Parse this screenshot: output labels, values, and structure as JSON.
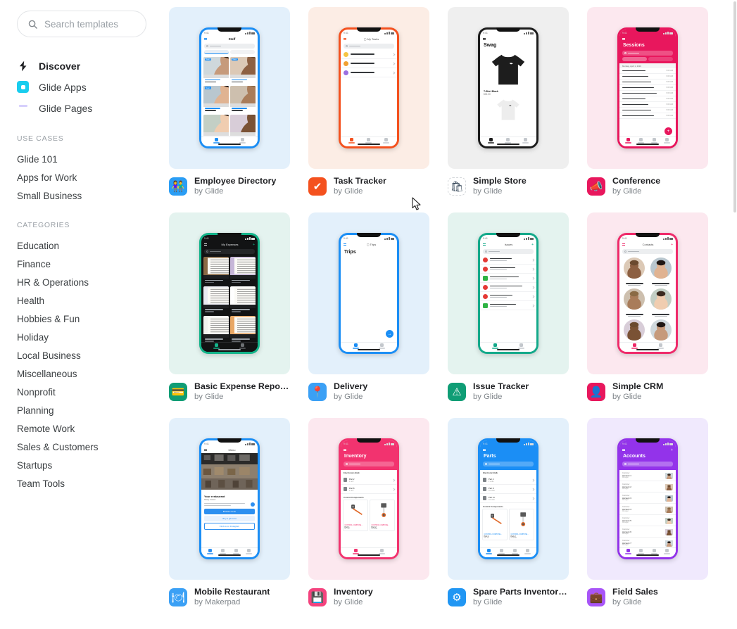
{
  "search": {
    "placeholder": "Search templates",
    "value": "",
    "icon": "search-icon"
  },
  "sidebar": {
    "nav": [
      {
        "label": "Discover",
        "icon": "lightning-bolt-icon",
        "active": true
      },
      {
        "label": "Glide Apps",
        "icon": "glide-apps-icon",
        "active": false
      },
      {
        "label": "Glide Pages",
        "icon": "glide-pages-icon",
        "active": false
      }
    ],
    "use_cases_header": "USE CASES",
    "use_cases": [
      "Glide 101",
      "Apps for Work",
      "Small Business"
    ],
    "categories_header": "CATEGORIES",
    "categories": [
      "Education",
      "Finance",
      "HR & Operations",
      "Health",
      "Hobbies & Fun",
      "Holiday",
      "Local Business",
      "Miscellaneous",
      "Nonprofit",
      "Planning",
      "Remote Work",
      "Sales & Customers",
      "Startups",
      "Team Tools"
    ]
  },
  "templates": [
    {
      "name": "Employee Directory",
      "author": "by Glide",
      "icon": "people-icon",
      "icon_glyph": "👫",
      "icon_bg": "#2a9df4",
      "card_bg": "#e3f0fb",
      "bezel": "#1b8ef5",
      "accent": "#1b8ef5",
      "screen_title": "Staff",
      "layout": "photo-grid-2col",
      "dark": false,
      "tabs": [
        "Staff",
        "Home"
      ]
    },
    {
      "name": "Task Tracker",
      "author": "by Glide",
      "icon": "checkmark-icon",
      "icon_glyph": "✔",
      "icon_bg": "#f4511e",
      "card_bg": "#fcede5",
      "bezel": "#f4511e",
      "accent": "#f4511e",
      "screen_title": "My Tasks",
      "layout": "emoji-list",
      "dark": false,
      "tabs": [
        "Categories",
        "All Tasks",
        "Done Tasks"
      ]
    },
    {
      "name": "Simple Store",
      "author": "by Glide",
      "icon": "shopping-bag-icon",
      "icon_glyph": "🛍",
      "icon_bg": "#ffffff",
      "card_bg": "#efefef",
      "bezel": "#1c1c1c",
      "accent": "#1c1c1c",
      "screen_title": "Swag",
      "layout": "product-hero",
      "dark": false,
      "product_name": "T-Shirt Black",
      "product_price": "$32.00",
      "tabs": [
        "Shop",
        "Cart",
        "Contact Us"
      ]
    },
    {
      "name": "Conference",
      "author": "by Glide",
      "icon": "megaphone-icon",
      "icon_glyph": "📣",
      "icon_bg": "#e8175d",
      "card_bg": "#fce8ef",
      "bezel": "#e8175d",
      "accent": "#e8175d",
      "screen_title": "Sessions",
      "layout": "session-list",
      "dark": false,
      "tabs": [
        "Sessions",
        "Speakers",
        "Venue",
        "Chat"
      ]
    },
    {
      "name": "Basic Expense Reporter",
      "author": "by Glide",
      "icon": "credit-card-icon",
      "icon_glyph": "💳",
      "icon_bg": "#0f9d75",
      "card_bg": "#e4f3ef",
      "bezel": "#13b48a",
      "accent": "#13b48a",
      "screen_title": "My Expenses",
      "layout": "receipt-grid",
      "dark": true,
      "tabs": [
        "My Expenses",
        "Reports"
      ]
    },
    {
      "name": "Delivery",
      "author": "by Glide",
      "icon": "location-pin-icon",
      "icon_glyph": "📍",
      "icon_bg": "#3ba0f5",
      "card_bg": "#e3f0fb",
      "bezel": "#1b8ef5",
      "accent": "#1b8ef5",
      "screen_title": "Trips",
      "layout": "empty-fab",
      "dark": false,
      "tabs": [
        "All Trips",
        "Drivers"
      ]
    },
    {
      "name": "Issue Tracker",
      "author": "by Glide",
      "icon": "warning-triangle-icon",
      "icon_glyph": "⚠",
      "icon_bg": "#0f9d75",
      "card_bg": "#e4f3ef",
      "bezel": "#13a98a",
      "accent": "#13a98a",
      "screen_title": "Issues",
      "layout": "status-list",
      "dark": false,
      "tabs": [
        "Issues",
        "By Group"
      ]
    },
    {
      "name": "Simple CRM",
      "author": "by Glide",
      "icon": "contact-person-icon",
      "icon_glyph": "👤",
      "icon_bg": "#e8175d",
      "card_bg": "#fce8ef",
      "bezel": "#ef2a6a",
      "accent": "#ef2a6a",
      "screen_title": "Contacts",
      "layout": "avatar-grid",
      "dark": false,
      "tabs": [
        "Contacts",
        "Tasks"
      ]
    },
    {
      "name": "Mobile Restaurant",
      "author": "by Makerpad",
      "icon": "restaurant-icon",
      "icon_glyph": "🍽",
      "icon_bg": "#3ba0f5",
      "card_bg": "#e3f0fb",
      "bezel": "#1b8ef5",
      "accent": "#2d8ff0",
      "screen_title": "Menu",
      "layout": "restaurant-hero",
      "dark": false,
      "hero_heading": "Your restaurant",
      "hero_sub": "Tasty. Good.",
      "buttons": [
        "Browse menu",
        "Buy a gift card",
        "Find us on Instagram"
      ],
      "tabs": [
        "Home",
        "Menu",
        "Cart",
        "Gift Cards"
      ]
    },
    {
      "name": "Inventory",
      "author": "by Glide",
      "icon": "save-disk-icon",
      "icon_glyph": "💾",
      "icon_bg": "#f4437e",
      "card_bg": "#fce8ef",
      "bezel": "#f2336f",
      "accent": "#f2336f",
      "screen_title": "Inventory",
      "layout": "inventory-list",
      "dark": false,
      "section_a": "Electronics Bulk",
      "section_b": "Control Components",
      "rows": [
        {
          "t": "Part 2",
          "s": "1 unit"
        },
        {
          "t": "Part 8",
          "s": "1 unit"
        }
      ],
      "tabs": [
        "Inventory",
        "Orders"
      ]
    },
    {
      "name": "Spare Parts Inventory...",
      "author": "by Glide",
      "icon": "gear-icon",
      "icon_glyph": "⚙",
      "icon_bg": "#2196f3",
      "card_bg": "#e3f0fb",
      "bezel": "#1b8ef5",
      "accent": "#1b8ef5",
      "screen_title": "Parts",
      "layout": "inventory-list",
      "dark": false,
      "section_a": "Electronic Bulk",
      "section_b": "Control Components",
      "rows": [
        {
          "t": "Part 4",
          "s": "1 units"
        },
        {
          "t": "Part 8",
          "s": "10 units"
        },
        {
          "t": "Part 11",
          "s": "10 units"
        }
      ],
      "tabs": [
        "Bulk Items",
        "Control",
        "Request",
        "Search"
      ]
    },
    {
      "name": "Field Sales",
      "author": "by Glide",
      "icon": "briefcase-icon",
      "icon_glyph": "💼",
      "icon_bg": "#a855f7",
      "card_bg": "#f0e9fd",
      "bezel": "#9333ea",
      "accent": "#9333ea",
      "screen_title": "Accounts",
      "layout": "account-list",
      "dark": false,
      "tabs": [
        "Deals",
        "Accounts",
        "Tasks",
        "More"
      ]
    }
  ]
}
